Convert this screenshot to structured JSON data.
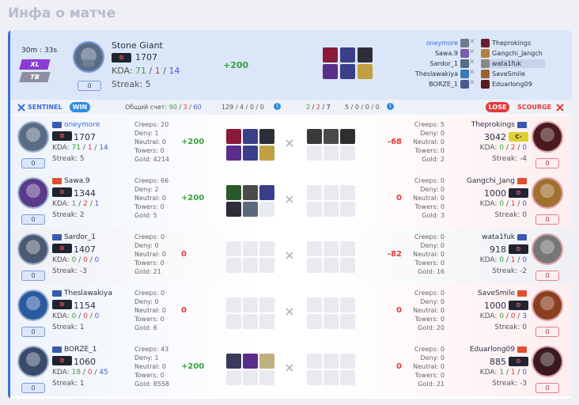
{
  "title": "Инфа о матче",
  "header": {
    "duration": "30m : 33s",
    "mode_badges": [
      "XL",
      "TB"
    ],
    "player": "Stone Giant",
    "tier": "D",
    "gold": "1707",
    "kda_label": "KDA:",
    "kda": {
      "k": "71",
      "d": "1",
      "a": "14"
    },
    "streak": "Streak: 5",
    "level": "0",
    "delta": "+200",
    "left_names": [
      "oneymore",
      "Sawa.9",
      "Sardor_1",
      "Theslawakiya",
      "BORZE_1"
    ],
    "right_names": [
      "Theprokings",
      "Gangchi_Jangch",
      "wata1fuk",
      "SaveSmile",
      "Eduarlong09"
    ]
  },
  "bar": {
    "sentinel": "SENTINEL",
    "win": "WIN",
    "score_label": "Общий счет:",
    "score": {
      "a": "90",
      "b": "3",
      "c": "60"
    },
    "left_summary": "129 / 4 / 0 / 0",
    "right_summary_a": {
      "k": "2",
      "d": "2",
      "a": "7"
    },
    "right_summary_b": "5 / 0 / 0 / 0",
    "lose": "LOSE",
    "scourge": "SCOURGE"
  },
  "labels": {
    "creeps": "Creeps:",
    "deny": "Deny:",
    "neutral": "Neutral:",
    "towers": "Towers:",
    "gold": "Gold:",
    "kda": "KDA:"
  },
  "rows": [
    {
      "l": {
        "name": "oneymore",
        "tier": "D",
        "gold": "1707",
        "k": "71",
        "d": "1",
        "a": "14",
        "streak": "Streak: 5",
        "level": "0",
        "creeps": "20",
        "deny": "1",
        "neutral": "0",
        "towers": "0",
        "goldv": "4214",
        "delta": "+200"
      },
      "r": {
        "name": "Theprokings",
        "tier": "C-",
        "gold": "3042",
        "k": "0",
        "d": "2",
        "a": "0",
        "streak": "Streak: -4",
        "level": "0",
        "creeps": "5",
        "deny": "0",
        "neutral": "0",
        "towers": "0",
        "goldv": "2",
        "delta": "-68"
      }
    },
    {
      "l": {
        "name": "Sawa.9",
        "tier": "D",
        "gold": "1344",
        "k": "1",
        "d": "2",
        "a": "1",
        "streak": "Streak: 2",
        "level": "0",
        "creeps": "66",
        "deny": "2",
        "neutral": "0",
        "towers": "0",
        "goldv": "5",
        "delta": "+200"
      },
      "r": {
        "name": "Gangchi_Jang",
        "tier": "D",
        "gold": "1000",
        "k": "0",
        "d": "1",
        "a": "0",
        "streak": "Streak: 0",
        "level": "0",
        "creeps": "0",
        "deny": "0",
        "neutral": "0",
        "towers": "0",
        "goldv": "3",
        "delta": "0"
      }
    },
    {
      "l": {
        "name": "Sardor_1",
        "tier": "D",
        "gold": "1407",
        "k": "0",
        "d": "0",
        "a": "0",
        "streak": "Streak: -3",
        "level": "0",
        "creeps": "0",
        "deny": "0",
        "neutral": "0",
        "towers": "0",
        "goldv": "21",
        "delta": "0"
      },
      "r": {
        "name": "wata1fuk",
        "tier": "D",
        "gold": "918",
        "k": "0",
        "d": "1",
        "a": "0",
        "streak": "Streak: -2",
        "level": "0",
        "creeps": "0",
        "deny": "0",
        "neutral": "0",
        "towers": "0",
        "goldv": "16",
        "delta": "-82"
      }
    },
    {
      "l": {
        "name": "Theslawakiya",
        "tier": "D",
        "gold": "1154",
        "k": "0",
        "d": "0",
        "a": "0",
        "streak": "Streak: 1",
        "level": "0",
        "creeps": "0",
        "deny": "0",
        "neutral": "0",
        "towers": "0",
        "goldv": "6",
        "delta": "0"
      },
      "r": {
        "name": "SaveSmile",
        "tier": "D",
        "gold": "1000",
        "k": "0",
        "d": "0",
        "a": "3",
        "streak": "Streak: 0",
        "level": "0",
        "creeps": "0",
        "deny": "0",
        "neutral": "0",
        "towers": "0",
        "goldv": "20",
        "delta": "0"
      }
    },
    {
      "l": {
        "name": "BORZE_1",
        "tier": "D",
        "gold": "1060",
        "k": "18",
        "d": "0",
        "a": "45",
        "streak": "Streak: 1",
        "level": "0",
        "creeps": "43",
        "deny": "1",
        "neutral": "0",
        "towers": "0",
        "goldv": "8558",
        "delta": "+200"
      },
      "r": {
        "name": "Eduarlong09",
        "tier": "D",
        "gold": "885",
        "k": "1",
        "d": "1",
        "a": "0",
        "streak": "Streak: -3",
        "level": "0",
        "creeps": "0",
        "deny": "0",
        "neutral": "0",
        "towers": "0",
        "goldv": "21",
        "delta": "0"
      }
    }
  ],
  "colors": {
    "accent": "#3b6fd8",
    "win": "#2f8de0",
    "lose": "#e33a3a",
    "green": "#3aa13a",
    "red": "#e03c3c",
    "blue": "#4a5fd0"
  }
}
